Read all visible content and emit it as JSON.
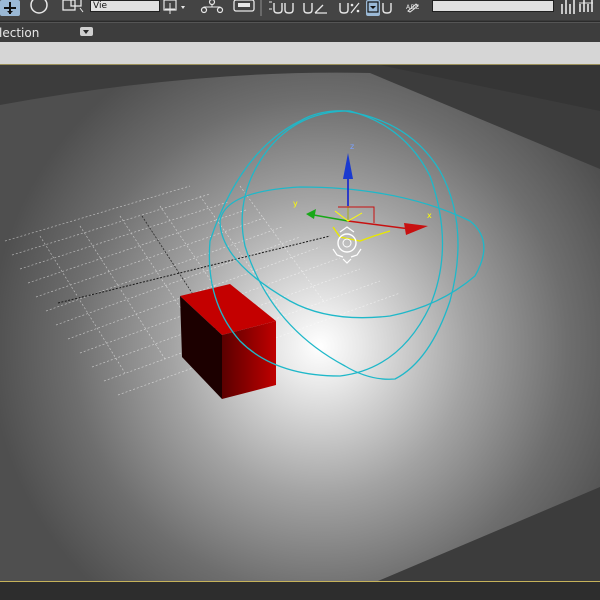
{
  "toolbar": {
    "selection_field_value": "Vie",
    "named_selection_value": "",
    "spelling_button_label": "ABC"
  },
  "ribbon": {
    "label": "lection"
  },
  "viewport": {
    "axis_x_label": "x",
    "axis_y_label": "y",
    "axis_z_label": "z",
    "colors": {
      "gizmo": "#1fb8c9",
      "box": "#b00000",
      "axis_x": "#c81010",
      "axis_y": "#17a817",
      "axis_z": "#1020d0",
      "axis_hl": "#ffff00"
    }
  }
}
